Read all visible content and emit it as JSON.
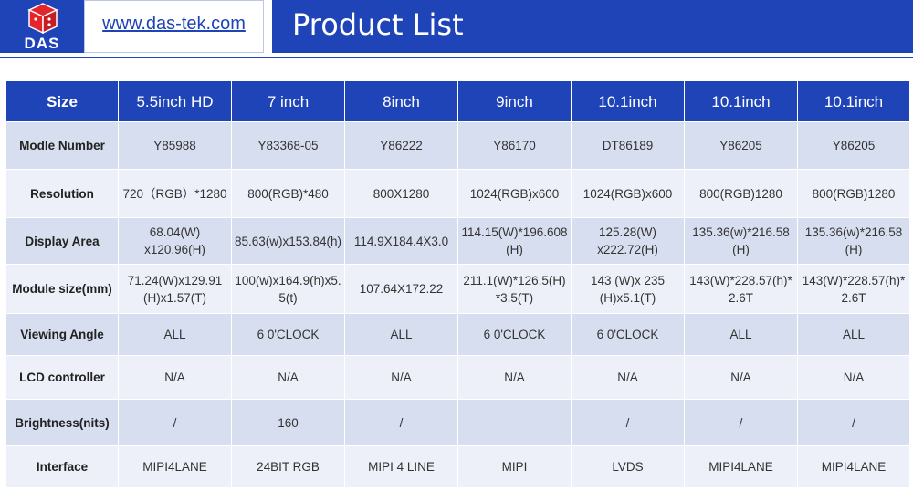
{
  "header": {
    "logo_text": "DAS",
    "url": "www.das-tek.com",
    "title": "Product List",
    "brand_color": "#1f44b8",
    "logo_color": "#e3262b"
  },
  "table": {
    "header_label": "Size",
    "sizes": [
      "5.5inch HD",
      "7 inch",
      "8inch",
      "9inch",
      "10.1inch",
      "10.1inch",
      "10.1inch"
    ],
    "rows": [
      {
        "label": "Modle Number",
        "values": [
          "Y85988",
          "Y83368-05",
          "Y86222",
          "Y86170",
          "DT86189",
          "Y86205",
          "Y86205"
        ]
      },
      {
        "label": "Resolution",
        "values": [
          "720（RGB）*1280",
          "800(RGB)*480",
          "800X1280",
          "1024(RGB)x600",
          "1024(RGB)x600",
          "800(RGB)1280",
          "800(RGB)1280"
        ]
      },
      {
        "label": "Display Area",
        "values": [
          "68.04(W) x120.96(H)",
          "85.63(w)x153.84(h)",
          "114.9X184.4X3.0",
          "114.15(W)*196.608 (H)",
          "125.28(W) x222.72(H)",
          "135.36(w)*216.58 (H)",
          "135.36(w)*216.58 (H)"
        ]
      },
      {
        "label": "Module size(mm)",
        "values": [
          "71.24(W)x129.91 (H)x1.57(T)",
          "100(w)x164.9(h)x5. 5(t)",
          "107.64X172.22",
          "211.1(W)*126.5(H) *3.5(T)",
          "143 (W)x 235 (H)x5.1(T)",
          "143(W)*228.57(h)* 2.6T",
          "143(W)*228.57(h)* 2.6T"
        ]
      },
      {
        "label": "Viewing Angle",
        "values": [
          "ALL",
          "6 0'CLOCK",
          "ALL",
          "6 0'CLOCK",
          "6 0'CLOCK",
          "ALL",
          "ALL"
        ]
      },
      {
        "label": "LCD controller",
        "values": [
          "N/A",
          "N/A",
          "N/A",
          "N/A",
          "N/A",
          "N/A",
          "N/A"
        ]
      },
      {
        "label": "Brightness(nits)",
        "values": [
          "/",
          "160",
          "/",
          "",
          "/",
          "/",
          "/"
        ]
      },
      {
        "label": "Interface",
        "values": [
          "MIPI4LANE",
          "24BIT RGB",
          "MIPI 4 LINE",
          "MIPI",
          "LVDS",
          "MIPI4LANE",
          "MIPI4LANE"
        ]
      }
    ]
  }
}
